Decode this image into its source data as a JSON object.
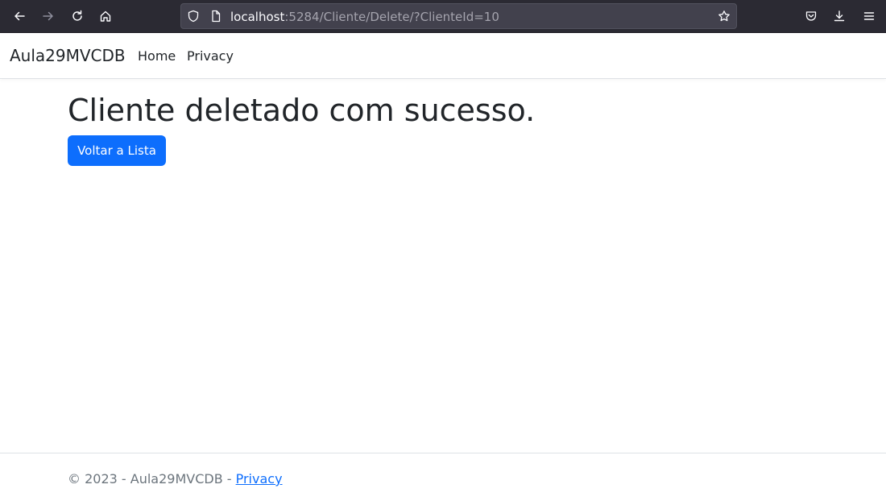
{
  "browser": {
    "url_host": "localhost",
    "url_path": ":5284/Cliente/Delete/?ClienteId=10",
    "icons": [
      "back-icon",
      "forward-icon",
      "reload-icon",
      "home-icon",
      "shield-icon",
      "page-icon",
      "star-icon",
      "pocket-icon",
      "download-icon",
      "menu-icon"
    ]
  },
  "navbar": {
    "brand": "Aula29MVCDB",
    "links": [
      {
        "label": "Home"
      },
      {
        "label": "Privacy"
      }
    ]
  },
  "main": {
    "title": "Cliente deletado com sucesso.",
    "button_label": "Voltar a Lista"
  },
  "footer": {
    "copyright": "© 2023 - Aula29MVCDB - ",
    "link_label": "Privacy"
  },
  "colors": {
    "primary": "#0d6efd",
    "browser_chrome": "#2b2a33",
    "urlbar": "#42414d"
  }
}
